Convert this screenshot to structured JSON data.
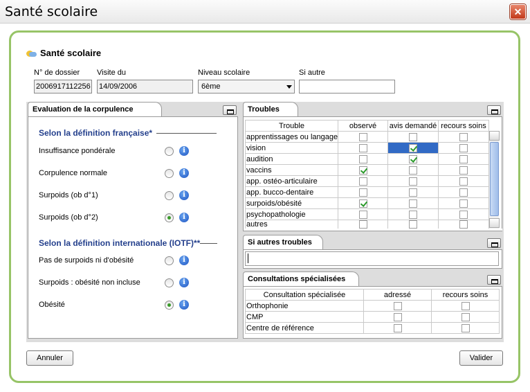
{
  "window": {
    "title": "Santé scolaire",
    "close_glyph": "✕"
  },
  "header": {
    "title": "Santé scolaire",
    "icon": "weather-icon"
  },
  "fields": {
    "dossier_label": "N° de dossier",
    "dossier_value": "2006917112256",
    "visite_label": "Visite du",
    "visite_value": "14/09/2006",
    "niveau_label": "Niveau scolaire",
    "niveau_value": "6ème",
    "siautre_label": "Si autre",
    "siautre_value": ""
  },
  "corpulence": {
    "tab_label": "Evaluation de la corpulence",
    "section_fr": "Selon la définition française",
    "section_fr_mark": "*",
    "section_int": "Selon la définition internationale (IOTF)",
    "section_int_mark": "**",
    "items": [
      {
        "label": "Insuffisance pondérale",
        "selected": false
      },
      {
        "label": "Corpulence normale",
        "selected": false
      },
      {
        "label": "Surpoids (ob d°1)",
        "selected": false
      },
      {
        "label": "Surpoids (ob d°2)",
        "selected": true
      },
      {
        "label": "Pas de surpoids ni d'obésité",
        "selected": false
      },
      {
        "label": "Surpoids : obésité non incluse",
        "selected": false
      },
      {
        "label": "Obésité",
        "selected": true
      }
    ]
  },
  "troubles": {
    "tab_label": "Troubles",
    "columns": [
      "Trouble",
      "observé",
      "avis demandé",
      "recours soins"
    ],
    "rows": [
      {
        "label": "apprentissages ou langage",
        "observe": false,
        "avis": false,
        "recours": false
      },
      {
        "label": "vision",
        "observe": false,
        "avis": true,
        "recours": false
      },
      {
        "label": "audition",
        "observe": false,
        "avis": true,
        "recours": false
      },
      {
        "label": "vaccins",
        "observe": true,
        "avis": false,
        "recours": false
      },
      {
        "label": "app. ostéo-articulaire",
        "observe": false,
        "avis": false,
        "recours": false
      },
      {
        "label": "app. bucco-dentaire",
        "observe": false,
        "avis": false,
        "recours": false
      },
      {
        "label": "surpoids/obésité",
        "observe": true,
        "avis": false,
        "recours": false
      },
      {
        "label": "psychopathologie",
        "observe": false,
        "avis": false,
        "recours": false
      },
      {
        "label": "autres",
        "observe": false,
        "avis": false,
        "recours": false
      }
    ]
  },
  "autres": {
    "tab_label": "Si autres troubles",
    "value": ""
  },
  "consultations": {
    "tab_label": "Consultations spécialisées",
    "columns": [
      "Consultation spécialisée",
      "adressé",
      "recours soins"
    ],
    "rows": [
      {
        "label": "Orthophonie",
        "adresse": false,
        "recours": false
      },
      {
        "label": "CMP",
        "adresse": false,
        "recours": false
      },
      {
        "label": "Centre de référence",
        "adresse": false,
        "recours": false
      }
    ]
  },
  "buttons": {
    "cancel": "Annuler",
    "validate": "Valider"
  },
  "colors": {
    "frame": "#97c467",
    "section": "#233f8c",
    "selection": "#316ac5"
  }
}
